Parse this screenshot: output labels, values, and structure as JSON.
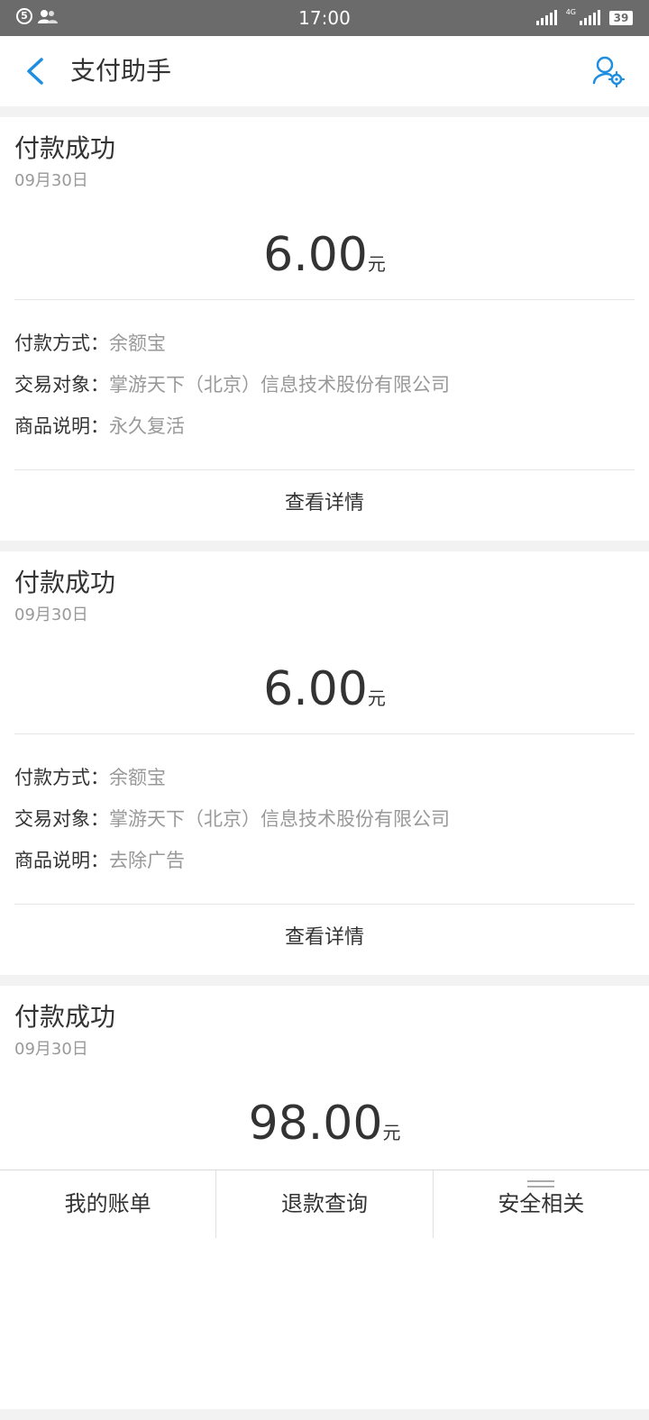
{
  "statusbar": {
    "notification_count": "5",
    "time": "17:00",
    "network_label": "4G",
    "battery": "39"
  },
  "header": {
    "title": "支付助手"
  },
  "cards": [
    {
      "status": "付款成功",
      "date": "09月30日",
      "amount": "6.00",
      "unit": "元",
      "method_label": "付款方式：",
      "method_value": "余额宝",
      "counterparty_label": "交易对象：",
      "counterparty_value": "掌游天下（北京）信息技术股份有限公司",
      "item_label": "商品说明：",
      "item_value": "永久复活",
      "detail_link": "查看详情"
    },
    {
      "status": "付款成功",
      "date": "09月30日",
      "amount": "6.00",
      "unit": "元",
      "method_label": "付款方式：",
      "method_value": "余额宝",
      "counterparty_label": "交易对象：",
      "counterparty_value": "掌游天下（北京）信息技术股份有限公司",
      "item_label": "商品说明：",
      "item_value": "去除广告",
      "detail_link": "查看详情"
    },
    {
      "status": "付款成功",
      "date": "09月30日",
      "amount": "98.00",
      "unit": "元"
    }
  ],
  "tabbar": {
    "tabs": [
      {
        "label": "我的账单"
      },
      {
        "label": "退款查询"
      },
      {
        "label": "安全相关"
      }
    ]
  },
  "colors": {
    "accent": "#1e8ee0",
    "text": "#333333",
    "muted": "#999999",
    "background": "#f2f2f2"
  }
}
